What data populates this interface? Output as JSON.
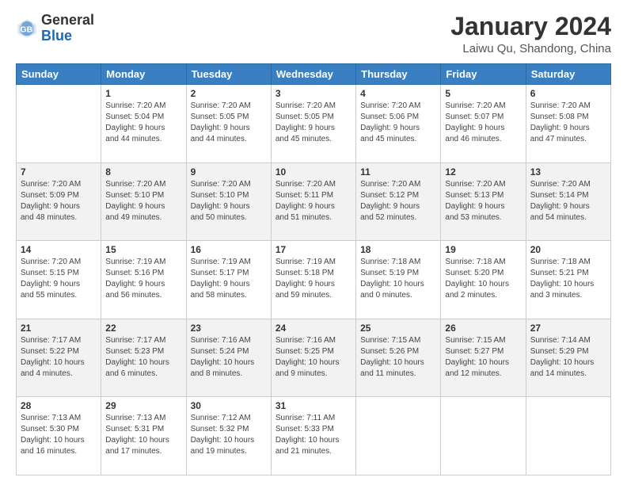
{
  "header": {
    "logo_line1": "General",
    "logo_line2": "Blue",
    "title": "January 2024",
    "subtitle": "Laiwu Qu, Shandong, China"
  },
  "columns": [
    "Sunday",
    "Monday",
    "Tuesday",
    "Wednesday",
    "Thursday",
    "Friday",
    "Saturday"
  ],
  "weeks": [
    {
      "shaded": false,
      "days": [
        {
          "num": "",
          "info": ""
        },
        {
          "num": "1",
          "info": "Sunrise: 7:20 AM\nSunset: 5:04 PM\nDaylight: 9 hours\nand 44 minutes."
        },
        {
          "num": "2",
          "info": "Sunrise: 7:20 AM\nSunset: 5:05 PM\nDaylight: 9 hours\nand 44 minutes."
        },
        {
          "num": "3",
          "info": "Sunrise: 7:20 AM\nSunset: 5:05 PM\nDaylight: 9 hours\nand 45 minutes."
        },
        {
          "num": "4",
          "info": "Sunrise: 7:20 AM\nSunset: 5:06 PM\nDaylight: 9 hours\nand 45 minutes."
        },
        {
          "num": "5",
          "info": "Sunrise: 7:20 AM\nSunset: 5:07 PM\nDaylight: 9 hours\nand 46 minutes."
        },
        {
          "num": "6",
          "info": "Sunrise: 7:20 AM\nSunset: 5:08 PM\nDaylight: 9 hours\nand 47 minutes."
        }
      ]
    },
    {
      "shaded": true,
      "days": [
        {
          "num": "7",
          "info": "Sunrise: 7:20 AM\nSunset: 5:09 PM\nDaylight: 9 hours\nand 48 minutes."
        },
        {
          "num": "8",
          "info": "Sunrise: 7:20 AM\nSunset: 5:10 PM\nDaylight: 9 hours\nand 49 minutes."
        },
        {
          "num": "9",
          "info": "Sunrise: 7:20 AM\nSunset: 5:10 PM\nDaylight: 9 hours\nand 50 minutes."
        },
        {
          "num": "10",
          "info": "Sunrise: 7:20 AM\nSunset: 5:11 PM\nDaylight: 9 hours\nand 51 minutes."
        },
        {
          "num": "11",
          "info": "Sunrise: 7:20 AM\nSunset: 5:12 PM\nDaylight: 9 hours\nand 52 minutes."
        },
        {
          "num": "12",
          "info": "Sunrise: 7:20 AM\nSunset: 5:13 PM\nDaylight: 9 hours\nand 53 minutes."
        },
        {
          "num": "13",
          "info": "Sunrise: 7:20 AM\nSunset: 5:14 PM\nDaylight: 9 hours\nand 54 minutes."
        }
      ]
    },
    {
      "shaded": false,
      "days": [
        {
          "num": "14",
          "info": "Sunrise: 7:20 AM\nSunset: 5:15 PM\nDaylight: 9 hours\nand 55 minutes."
        },
        {
          "num": "15",
          "info": "Sunrise: 7:19 AM\nSunset: 5:16 PM\nDaylight: 9 hours\nand 56 minutes."
        },
        {
          "num": "16",
          "info": "Sunrise: 7:19 AM\nSunset: 5:17 PM\nDaylight: 9 hours\nand 58 minutes."
        },
        {
          "num": "17",
          "info": "Sunrise: 7:19 AM\nSunset: 5:18 PM\nDaylight: 9 hours\nand 59 minutes."
        },
        {
          "num": "18",
          "info": "Sunrise: 7:18 AM\nSunset: 5:19 PM\nDaylight: 10 hours\nand 0 minutes."
        },
        {
          "num": "19",
          "info": "Sunrise: 7:18 AM\nSunset: 5:20 PM\nDaylight: 10 hours\nand 2 minutes."
        },
        {
          "num": "20",
          "info": "Sunrise: 7:18 AM\nSunset: 5:21 PM\nDaylight: 10 hours\nand 3 minutes."
        }
      ]
    },
    {
      "shaded": true,
      "days": [
        {
          "num": "21",
          "info": "Sunrise: 7:17 AM\nSunset: 5:22 PM\nDaylight: 10 hours\nand 4 minutes."
        },
        {
          "num": "22",
          "info": "Sunrise: 7:17 AM\nSunset: 5:23 PM\nDaylight: 10 hours\nand 6 minutes."
        },
        {
          "num": "23",
          "info": "Sunrise: 7:16 AM\nSunset: 5:24 PM\nDaylight: 10 hours\nand 8 minutes."
        },
        {
          "num": "24",
          "info": "Sunrise: 7:16 AM\nSunset: 5:25 PM\nDaylight: 10 hours\nand 9 minutes."
        },
        {
          "num": "25",
          "info": "Sunrise: 7:15 AM\nSunset: 5:26 PM\nDaylight: 10 hours\nand 11 minutes."
        },
        {
          "num": "26",
          "info": "Sunrise: 7:15 AM\nSunset: 5:27 PM\nDaylight: 10 hours\nand 12 minutes."
        },
        {
          "num": "27",
          "info": "Sunrise: 7:14 AM\nSunset: 5:29 PM\nDaylight: 10 hours\nand 14 minutes."
        }
      ]
    },
    {
      "shaded": false,
      "days": [
        {
          "num": "28",
          "info": "Sunrise: 7:13 AM\nSunset: 5:30 PM\nDaylight: 10 hours\nand 16 minutes."
        },
        {
          "num": "29",
          "info": "Sunrise: 7:13 AM\nSunset: 5:31 PM\nDaylight: 10 hours\nand 17 minutes."
        },
        {
          "num": "30",
          "info": "Sunrise: 7:12 AM\nSunset: 5:32 PM\nDaylight: 10 hours\nand 19 minutes."
        },
        {
          "num": "31",
          "info": "Sunrise: 7:11 AM\nSunset: 5:33 PM\nDaylight: 10 hours\nand 21 minutes."
        },
        {
          "num": "",
          "info": ""
        },
        {
          "num": "",
          "info": ""
        },
        {
          "num": "",
          "info": ""
        }
      ]
    }
  ]
}
